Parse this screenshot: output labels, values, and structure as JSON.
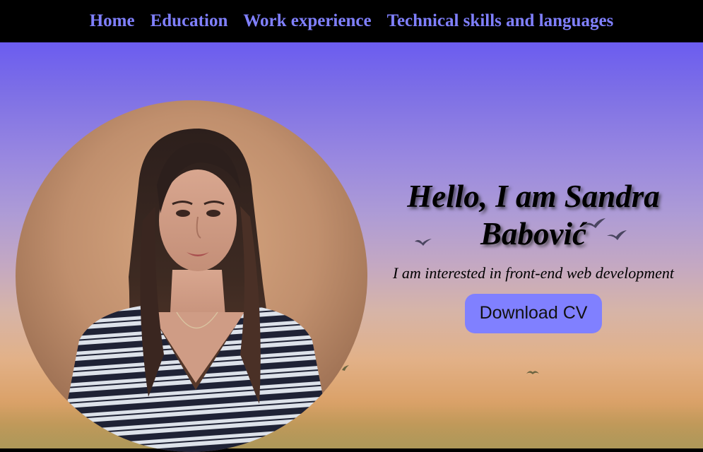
{
  "nav": {
    "items": [
      {
        "label": "Home"
      },
      {
        "label": "Education"
      },
      {
        "label": "Work experience"
      },
      {
        "label": "Technical skills and languages"
      }
    ]
  },
  "hero": {
    "name_line1": "Hello, I am Sandra",
    "name_line2": "Babović",
    "tagline": "I am interested in front-end web development",
    "cv_button": "Download CV"
  },
  "colors": {
    "accent": "#8080ff",
    "nav_bg": "#000000"
  },
  "icons": [
    "bird-icon"
  ]
}
